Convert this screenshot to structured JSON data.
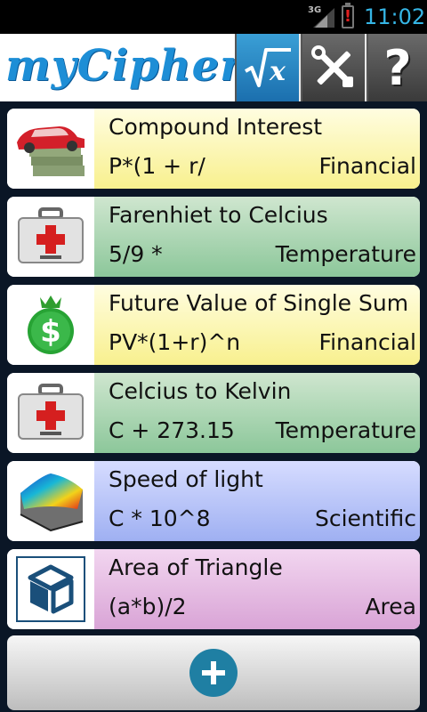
{
  "status_bar": {
    "network": "3G",
    "time": "11:02"
  },
  "header": {
    "logo_text": "myCipher",
    "buttons": {
      "formula": "sqrt-x-icon",
      "settings": "tools-icon",
      "help": "?"
    }
  },
  "formulas": [
    {
      "title": "Compound Interest",
      "formula": "P*(1 + r/",
      "category": "Financial",
      "color": "yellow",
      "icon": "car-money-icon"
    },
    {
      "title": "Farenhiet to Celcius",
      "formula": "5/9 *",
      "category": "Temperature",
      "color": "green",
      "icon": "medical-kit-icon"
    },
    {
      "title": "Future Value of Single Sum",
      "formula": "PV*(1+r)^n",
      "category": "Financial",
      "color": "yellow",
      "icon": "dollar-coin-icon"
    },
    {
      "title": "Celcius to Kelvin",
      "formula": "C + 273.15",
      "category": "Temperature",
      "color": "green",
      "icon": "medical-kit-icon"
    },
    {
      "title": "Speed of light",
      "formula": "C * 10^8",
      "category": "Scientific",
      "color": "blue",
      "icon": "surface-plot-icon"
    },
    {
      "title": "Area of Triangle",
      "formula": "(a*b)/2",
      "category": "Area",
      "color": "purple",
      "icon": "cube-icon"
    }
  ],
  "add_button": {
    "icon": "plus-icon"
  }
}
